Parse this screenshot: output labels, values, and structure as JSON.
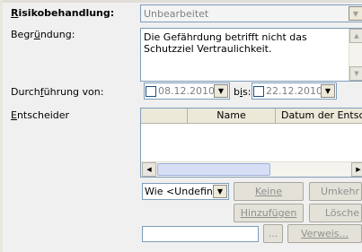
{
  "labels": {
    "risikobehandlung_first": "R",
    "risikobehandlung_rest": "isikobehandlung:",
    "begruendung_pre": "Begr",
    "begruendung_u": "ü",
    "begruendung_post": "ndung:",
    "durchfuehrung_pre": "Durch",
    "durchfuehrung_u": "f",
    "durchfuehrung_post": "ührung von:",
    "entscheider_first": "E",
    "entscheider_rest": "ntscheider"
  },
  "risikobehandlung": {
    "value": "Unbearbeitet"
  },
  "begruendung": {
    "text": "Die Gefährdung betrifft nicht das Schutzziel Vertraulichkeit."
  },
  "durchfuehrung": {
    "from": "08.12.2010",
    "bis_pre": "b",
    "bis_u": "i",
    "bis_post": "s:",
    "to": "22.12.2010"
  },
  "entscheider_table": {
    "columns": [
      "Name",
      "Datum der Entsch"
    ]
  },
  "controls": {
    "scope_select": "Wie <Undefinie",
    "keine_button": "Keine",
    "umkehren_button": "Umkehr",
    "hinzufuegen_button": "Hinzufügen",
    "loeschen_button": "Lösche",
    "ellipsis_button": "...",
    "verweis_button": "Verweis..."
  },
  "colors": {
    "field_border": "#7f9db9",
    "disabled_text": "#808080"
  }
}
